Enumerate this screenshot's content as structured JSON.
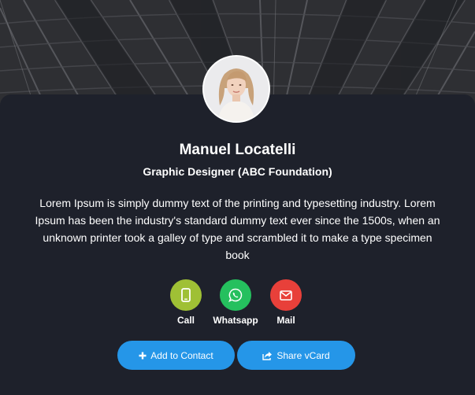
{
  "profile": {
    "name": "Manuel Locatelli",
    "title": "Graphic Designer (ABC Foundation)",
    "bio": "Lorem Ipsum is simply dummy text of the printing and typesetting industry. Lorem Ipsum has been the industry's standard dummy text ever since the 1500s, when an unknown printer took a galley of type and scrambled it to make a type specimen book"
  },
  "actions": [
    {
      "label": "Call",
      "icon": "phone-icon",
      "color": "#9fc035"
    },
    {
      "label": "Whatsapp",
      "icon": "whatsapp-icon",
      "color": "#25c05e"
    },
    {
      "label": "Mail",
      "icon": "mail-icon",
      "color": "#e8403a"
    }
  ],
  "buttons": {
    "add_contact": {
      "label": "Add to Contact",
      "icon": "plus-icon"
    },
    "share_vcard": {
      "label": "Share vCard",
      "icon": "share-icon"
    }
  },
  "colors": {
    "background": "#1e212b",
    "button": "#2596e8"
  }
}
